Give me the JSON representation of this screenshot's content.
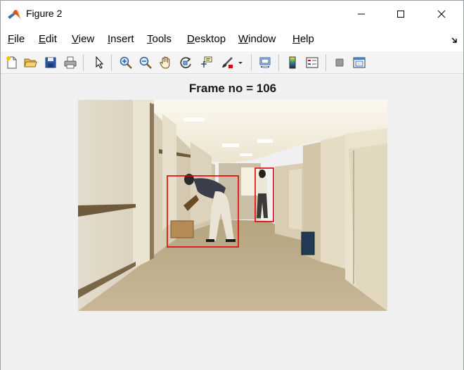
{
  "window": {
    "title": "Figure 2"
  },
  "menu": [
    {
      "mnemonic": "F",
      "rest": "ile"
    },
    {
      "mnemonic": "E",
      "rest": "dit"
    },
    {
      "mnemonic": "V",
      "rest": "iew"
    },
    {
      "mnemonic": "I",
      "rest": "nsert"
    },
    {
      "mnemonic": "T",
      "rest": "ools"
    },
    {
      "mnemonic": "D",
      "rest": "esktop"
    },
    {
      "mnemonic": "W",
      "rest": "indow"
    },
    {
      "mnemonic": "H",
      "rest": "elp"
    }
  ],
  "toolbar": {
    "icons": [
      "new-figure-icon",
      "open-file-icon",
      "save-icon",
      "print-icon",
      "edit-plot-cursor-icon",
      "zoom-in-icon",
      "zoom-out-icon",
      "pan-hand-icon",
      "rotate-3d-icon",
      "data-cursor-icon",
      "brush-icon",
      "brush-dropdown-icon",
      "link-plot-icon",
      "insert-colorbar-icon",
      "insert-legend-icon",
      "hide-plot-tools-icon",
      "show-plot-tools-icon"
    ]
  },
  "figure": {
    "title": "Frame no = 106",
    "detections": 2,
    "box_color": "#e00000"
  }
}
